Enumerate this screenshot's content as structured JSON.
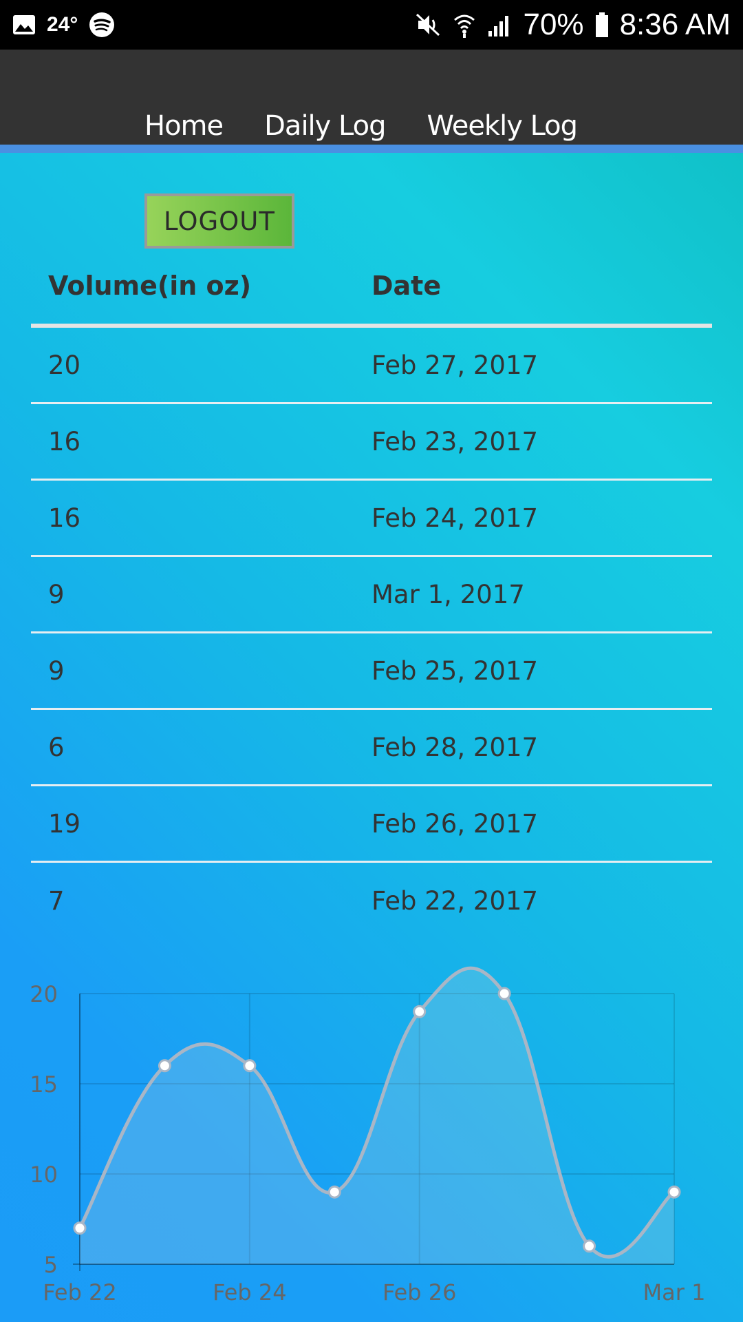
{
  "status_bar": {
    "temperature": "24°",
    "battery": "70%",
    "time": "8:36 AM",
    "icons": [
      "image-icon",
      "spotify-icon",
      "mute-icon",
      "wifi-icon",
      "signal-icon",
      "battery-icon"
    ]
  },
  "nav": {
    "items": [
      {
        "label": "Home"
      },
      {
        "label": "Daily Log"
      },
      {
        "label": "Weekly Log"
      }
    ]
  },
  "logout_label": "LOGOUT",
  "table": {
    "headers": [
      "Volume(in oz)",
      "Date"
    ],
    "rows": [
      {
        "volume": "20",
        "date": "Feb 27, 2017"
      },
      {
        "volume": "16",
        "date": "Feb 23, 2017"
      },
      {
        "volume": "16",
        "date": "Feb 24, 2017"
      },
      {
        "volume": "9",
        "date": "Mar 1, 2017"
      },
      {
        "volume": "9",
        "date": "Feb 25, 2017"
      },
      {
        "volume": "6",
        "date": "Feb 28, 2017"
      },
      {
        "volume": "19",
        "date": "Feb 26, 2017"
      },
      {
        "volume": "7",
        "date": "Feb 22, 2017"
      }
    ]
  },
  "chart_data": {
    "type": "area",
    "x": [
      "Feb 22",
      "Feb 23",
      "Feb 24",
      "Feb 25",
      "Feb 26",
      "Feb 27",
      "Feb 28",
      "Mar 1"
    ],
    "values": [
      7,
      16,
      16,
      9,
      19,
      20,
      6,
      9
    ],
    "x_tick_labels": [
      "Feb 22",
      "Feb 24",
      "Feb 26",
      "Mar 1"
    ],
    "y_ticks": [
      5,
      10,
      15,
      20
    ],
    "ylim": [
      5,
      20
    ],
    "grid": true,
    "line_color": "#a9b6c6",
    "fill_color": "rgba(220,220,220,0.2)",
    "point_color": "#ffffff"
  }
}
